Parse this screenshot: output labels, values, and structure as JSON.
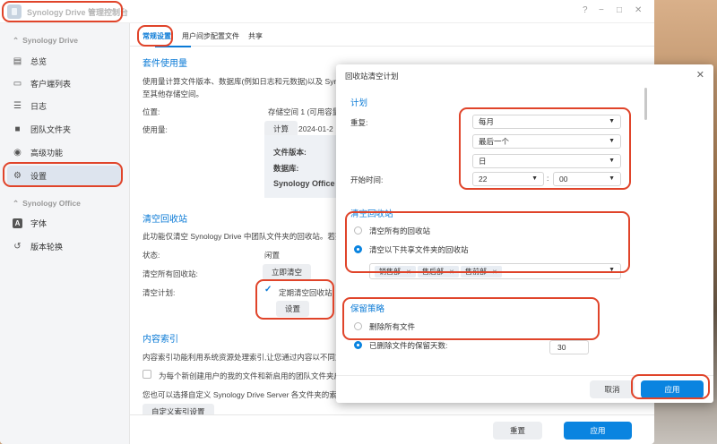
{
  "app": {
    "title": "Synology Drive 管理控制台",
    "window_controls": [
      "?",
      "−",
      "□",
      "✕"
    ]
  },
  "sidebar": {
    "groups": [
      {
        "label": "Synology Drive",
        "items": [
          {
            "label": "总览",
            "icon": "overview-icon"
          },
          {
            "label": "客户端列表",
            "icon": "client-list-icon"
          },
          {
            "label": "日志",
            "icon": "log-icon"
          },
          {
            "label": "团队文件夹",
            "icon": "team-folder-icon"
          },
          {
            "label": "高级功能",
            "icon": "advanced-icon"
          },
          {
            "label": "设置",
            "icon": "gear-icon",
            "active": true
          }
        ]
      },
      {
        "label": "Synology Office",
        "items": [
          {
            "label": "字体",
            "icon": "font-icon"
          },
          {
            "label": "版本轮换",
            "icon": "version-rotation-icon"
          }
        ]
      }
    ]
  },
  "tabs": [
    "常规设置",
    "用户间步配置文件",
    "共享"
  ],
  "main": {
    "usage": {
      "title": "套件使用量",
      "desc_line1": "使用量计算文件版本、数据库(例如日志和元数据)以及 Syn",
      "desc_line2": "至其他存储空间。",
      "location_label": "位置:",
      "location_value": "存储空间 1 (可用容量",
      "usage_label": "使用量:",
      "calc_button": "计算",
      "calc_date": "2024-01-2",
      "file_version_label": "文件版本:",
      "database_label": "数据库:",
      "synology_office_label": "Synology Office"
    },
    "recycle": {
      "title": "清空回收站",
      "desc": "此功能仅清空 Synology Drive 中团队文件夹的回收站。若要",
      "status_label": "状态:",
      "status_value": "闲置",
      "clear_all_label": "清空所有回收站:",
      "clear_now_button": "立即清空",
      "schedule_label": "清空计划:",
      "schedule_checkbox": "定期清空回收站",
      "settings_button": "设置"
    },
    "index": {
      "title": "内容索引",
      "desc": "内容索引功能利用系统资源处理索引,让您通过内容以不同方",
      "checkbox_label": "为每个新创建用户的我的文件和新启用的团队文件夹启用",
      "desc2": "您也可以选择自定义 Synology Drive Server 各文件夹的索",
      "custom_button": "自定义索引设置"
    }
  },
  "footer": {
    "reset": "重置",
    "apply": "应用"
  },
  "dialog": {
    "title": "回收站清空计划",
    "plan": {
      "title": "计划",
      "repeat_label": "重复:",
      "repeat_value": "每月",
      "week_value": "最后一个",
      "day_value": "日",
      "start_label": "开始时间:",
      "hour": "22",
      "minute": "00",
      "colon": ":"
    },
    "recycle": {
      "title": "清空回收站",
      "option_all": "清空所有的回收站",
      "option_selected": "清空以下共享文件夹的回收站",
      "folders": [
        "销售部",
        "售后部",
        "售前部"
      ]
    },
    "retention": {
      "title": "保留策略",
      "option_delete_all": "删除所有文件",
      "option_keep_days": "已删除文件的保留天数:",
      "days": "30"
    },
    "cancel": "取消",
    "apply": "应用"
  },
  "colors": {
    "accent": "#0a84e0",
    "highlight": "#e0442a"
  }
}
